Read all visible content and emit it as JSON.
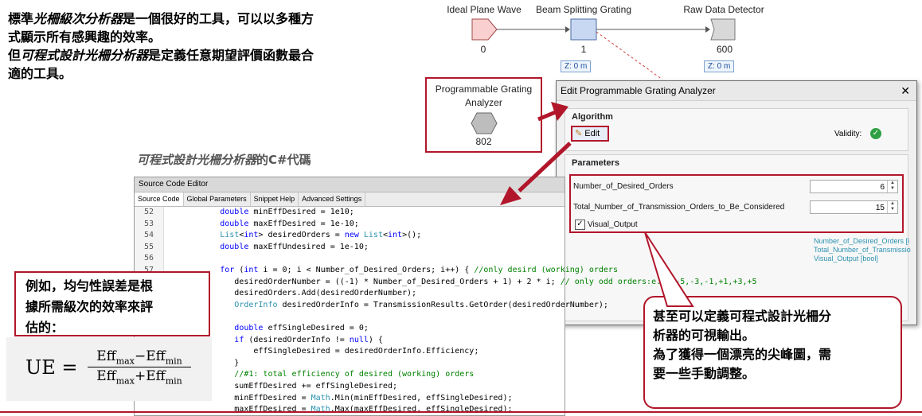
{
  "intro": {
    "line1_a": "標準",
    "line1_b": "光柵級次分析器",
    "line1_c": "是一個很好的工具，可以以多種方",
    "line2": "式顯示所有感興趣的效率。",
    "line3_a": "但",
    "line3_b": "可程式設計光柵分析器",
    "line3_c": "是定義任意期望評價函數最合",
    "line4": "適的工具。"
  },
  "flow": {
    "nodes": [
      {
        "name": "Ideal Plane Wave",
        "index": "0"
      },
      {
        "name": "Beam Splitting Grating",
        "index": "1",
        "z": "Z: 0 m"
      },
      {
        "name": "Raw Data Detector",
        "index": "600",
        "z": "Z: 0 m"
      }
    ],
    "analyzer": {
      "name_line1": "Programmable Grating",
      "name_line2": "Analyzer",
      "index": "802"
    }
  },
  "dialog": {
    "title": "Edit Programmable Grating Analyzer",
    "close": "✕",
    "algorithm_label": "Algorithm",
    "edit_button": "Edit",
    "validity_label": "Validity:",
    "parameters_label": "Parameters",
    "params": [
      {
        "label": "Number_of_Desired_Orders",
        "value": "6"
      },
      {
        "label": "Total_Number_of_Transmission_Orders_to_Be_Considered",
        "value": "15"
      }
    ],
    "visual_output_label": "Visual_Output"
  },
  "side_panel": {
    "items": [
      "Number_of_Desired_Orders [i",
      "Total_Number_of_Transmissio",
      "Visual_Output [bool]"
    ]
  },
  "editor_caption": {
    "a": "可程式設計光柵分析器",
    "b": "的C#代碼"
  },
  "editor": {
    "title": "Source Code Editor",
    "tabs": [
      "Source Code",
      "Global Parameters",
      "Snippet Help",
      "Advanced Settings"
    ]
  },
  "example": {
    "line1": "例如，均勻性誤差是根",
    "line2": "據所需級次的效率來評",
    "line3": "估的："
  },
  "formula": {
    "lhs": "UE",
    "eq": "=",
    "num": "Eff",
    "num_sub1": "max",
    "num_op": "−",
    "num_sub2": "min",
    "den_op": "+"
  },
  "callout": {
    "line1": "甚至可以定義可程式設計光柵分",
    "line2": "析器的可視輸出。",
    "line3": "為了獲得一個漂亮的尖峰圖，需",
    "line4": "要一些手動調整。"
  },
  "colors": {
    "accent": "#b2162b",
    "keyword": "#0000ff",
    "comment": "#008000",
    "type": "#2b91af"
  }
}
